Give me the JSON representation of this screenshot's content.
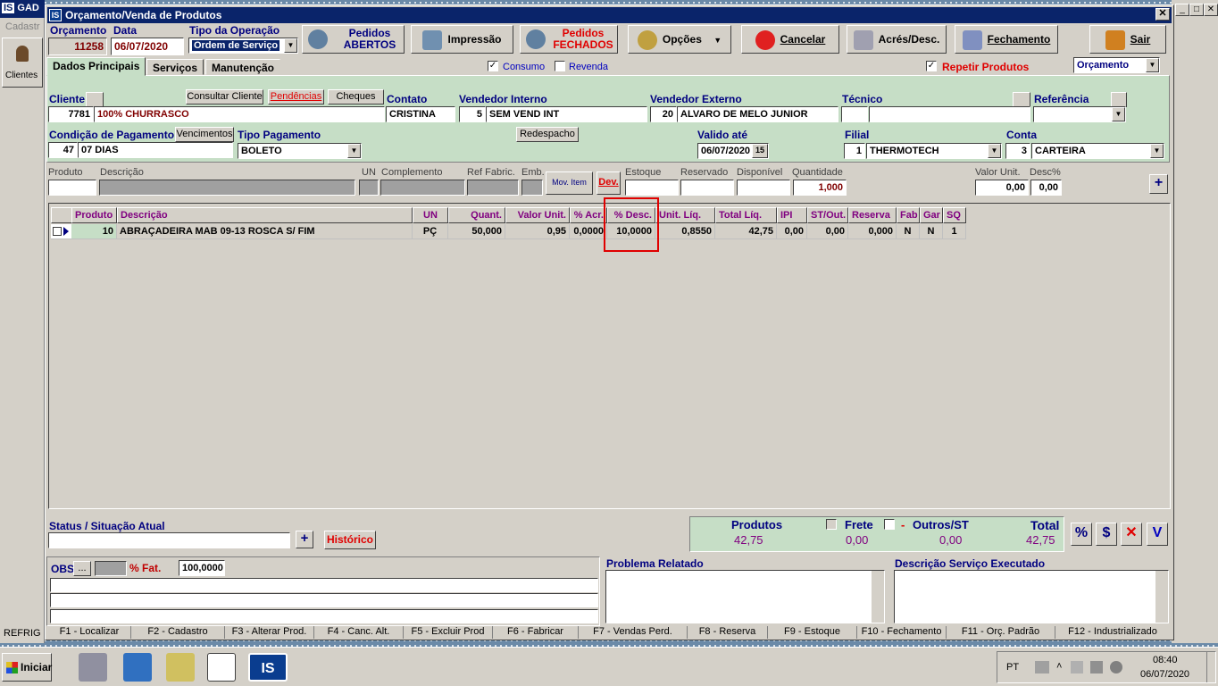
{
  "window": {
    "title": "Orçamento/Venda de Produtos"
  },
  "bg": {
    "app_title": "GAD",
    "cadastro": "Cadastr",
    "clientes": "Clientes",
    "refrig": "REFRIG"
  },
  "header": {
    "orcamento_label": "Orçamento",
    "orcamento_value": "11258",
    "data_label": "Data",
    "data_value": "06/07/2020",
    "tipo_label": "Tipo da Operação",
    "tipo_value": "Ordem de Serviço"
  },
  "toolbar": {
    "pedidos_abertos": [
      "Pedidos",
      "ABERTOS"
    ],
    "impressao": "Impressão",
    "pedidos_fechados": [
      "Pedidos",
      "FECHADOS"
    ],
    "opcoes": "Opções",
    "cancelar": "Cancelar",
    "acres": "Acrés/Desc.",
    "fechamento": "Fechamento",
    "sair": "Sair"
  },
  "tabs": [
    "Dados Principais",
    "Serviços",
    "Manutenção"
  ],
  "flags": {
    "consumo": "Consumo",
    "revenda": "Revenda",
    "repetir": "Repetir Produtos",
    "tipo_doc": "Orçamento"
  },
  "cliente": {
    "label": "Cliente",
    "codigo": "7781",
    "nome": "100% CHURRASCO",
    "consultar": "Consultar Cliente",
    "pendencias": "Pendências",
    "cheques": "Cheques",
    "contato_label": "Contato",
    "contato": "CRISTINA"
  },
  "vendedor_interno": {
    "label": "Vendedor Interno",
    "codigo": "5",
    "nome": "SEM VEND INT"
  },
  "vendedor_externo": {
    "label": "Vendedor Externo",
    "codigo": "20",
    "nome": "ALVARO DE MELO JUNIOR"
  },
  "tecnico": {
    "label": "Técnico"
  },
  "referencia": {
    "label": "Referência"
  },
  "pagamento": {
    "cond_label": "Condição de Pagamento",
    "cond_codigo": "47",
    "cond_nome": "07 DIAS",
    "vencimentos": "Vencimentos",
    "tipo_label": "Tipo Pagamento",
    "tipo_value": "BOLETO",
    "redespacho": "Redespacho",
    "valido_label": "Valido até",
    "valido_value": "06/07/2020",
    "cal_icon": "15"
  },
  "filial": {
    "label": "Filial",
    "codigo": "1",
    "nome": "THERMOTECH"
  },
  "conta": {
    "label": "Conta",
    "codigo": "3",
    "nome": "CARTEIRA"
  },
  "item_entry": {
    "produto": "Produto",
    "descricao": "Descrição",
    "un": "UN",
    "complemento": "Complemento",
    "ref": "Ref Fabric.",
    "emb": "Emb.",
    "mov_item": "Mov. Item",
    "dev": "Dev.",
    "estoque": "Estoque",
    "reservado": "Reservado",
    "disponivel": "Disponível",
    "quantidade": "Quantidade",
    "quantidade_value": "1,000",
    "valor_unit": "Valor Unit.",
    "valor_unit_value": "0,00",
    "desc_pct": "Desc%",
    "desc_pct_value": "0,00",
    "add": "+"
  },
  "grid": {
    "columns": [
      "Produto",
      "Descrição",
      "UN",
      "Quant.",
      "Valor Unit.",
      "% Acr.",
      "% Desc.",
      "Unit. Líq.",
      "Total Líq.",
      "IPI",
      "ST/Out.",
      "Reserva",
      "Fab",
      "Gar",
      "SQ"
    ],
    "rows": [
      [
        "10",
        "ABRAÇADEIRA MAB 09-13 ROSCA S/ FIM",
        "PÇ",
        "50,000",
        "0,95",
        "0,0000",
        "10,0000",
        "0,8550",
        "42,75",
        "0,00",
        "0,00",
        "0,000",
        "N",
        "N",
        "1"
      ]
    ]
  },
  "status": {
    "label": "Status / Situação Atual",
    "add": "+",
    "historico": "Histórico"
  },
  "totals": {
    "produtos_label": "Produtos",
    "produtos_value": "42,75",
    "frete_label": "Frete",
    "frete_value": "0,00",
    "outros_label": "Outros/ST",
    "outros_value": "0,00",
    "total_label": "Total",
    "total_value": "42,75",
    "btn_pct": "%",
    "btn_dollar": "$",
    "btn_x": "✕",
    "btn_v": "V"
  },
  "obs": {
    "label": "OBS",
    "dots": "...",
    "fat_label": "% Fat.",
    "fat_value": "100,0000"
  },
  "problema": {
    "label": "Problema Relatado"
  },
  "servico": {
    "label": "Descrição Serviço Executado"
  },
  "fkeys": [
    "F1 - Localizar",
    "F2 - Cadastro",
    "F3 - Alterar Prod.",
    "F4 - Canc. Alt.",
    "F5 - Excluir Prod",
    "F6 - Fabricar",
    "F7 - Vendas Perd.",
    "F8 - Reserva",
    "F9 - Estoque",
    "F10 - Fechamento",
    "F11 - Orç. Padrão",
    "F12 - Industrializado"
  ],
  "taskbar": {
    "start": "Iniciar",
    "lang": "PT",
    "time": "08:40",
    "date": "06/07/2020",
    "app_tag": "IS"
  },
  "colors": {
    "title": "#0a246a",
    "green": "#c6dec6",
    "highlight": "#e00000",
    "label": "#000080"
  }
}
